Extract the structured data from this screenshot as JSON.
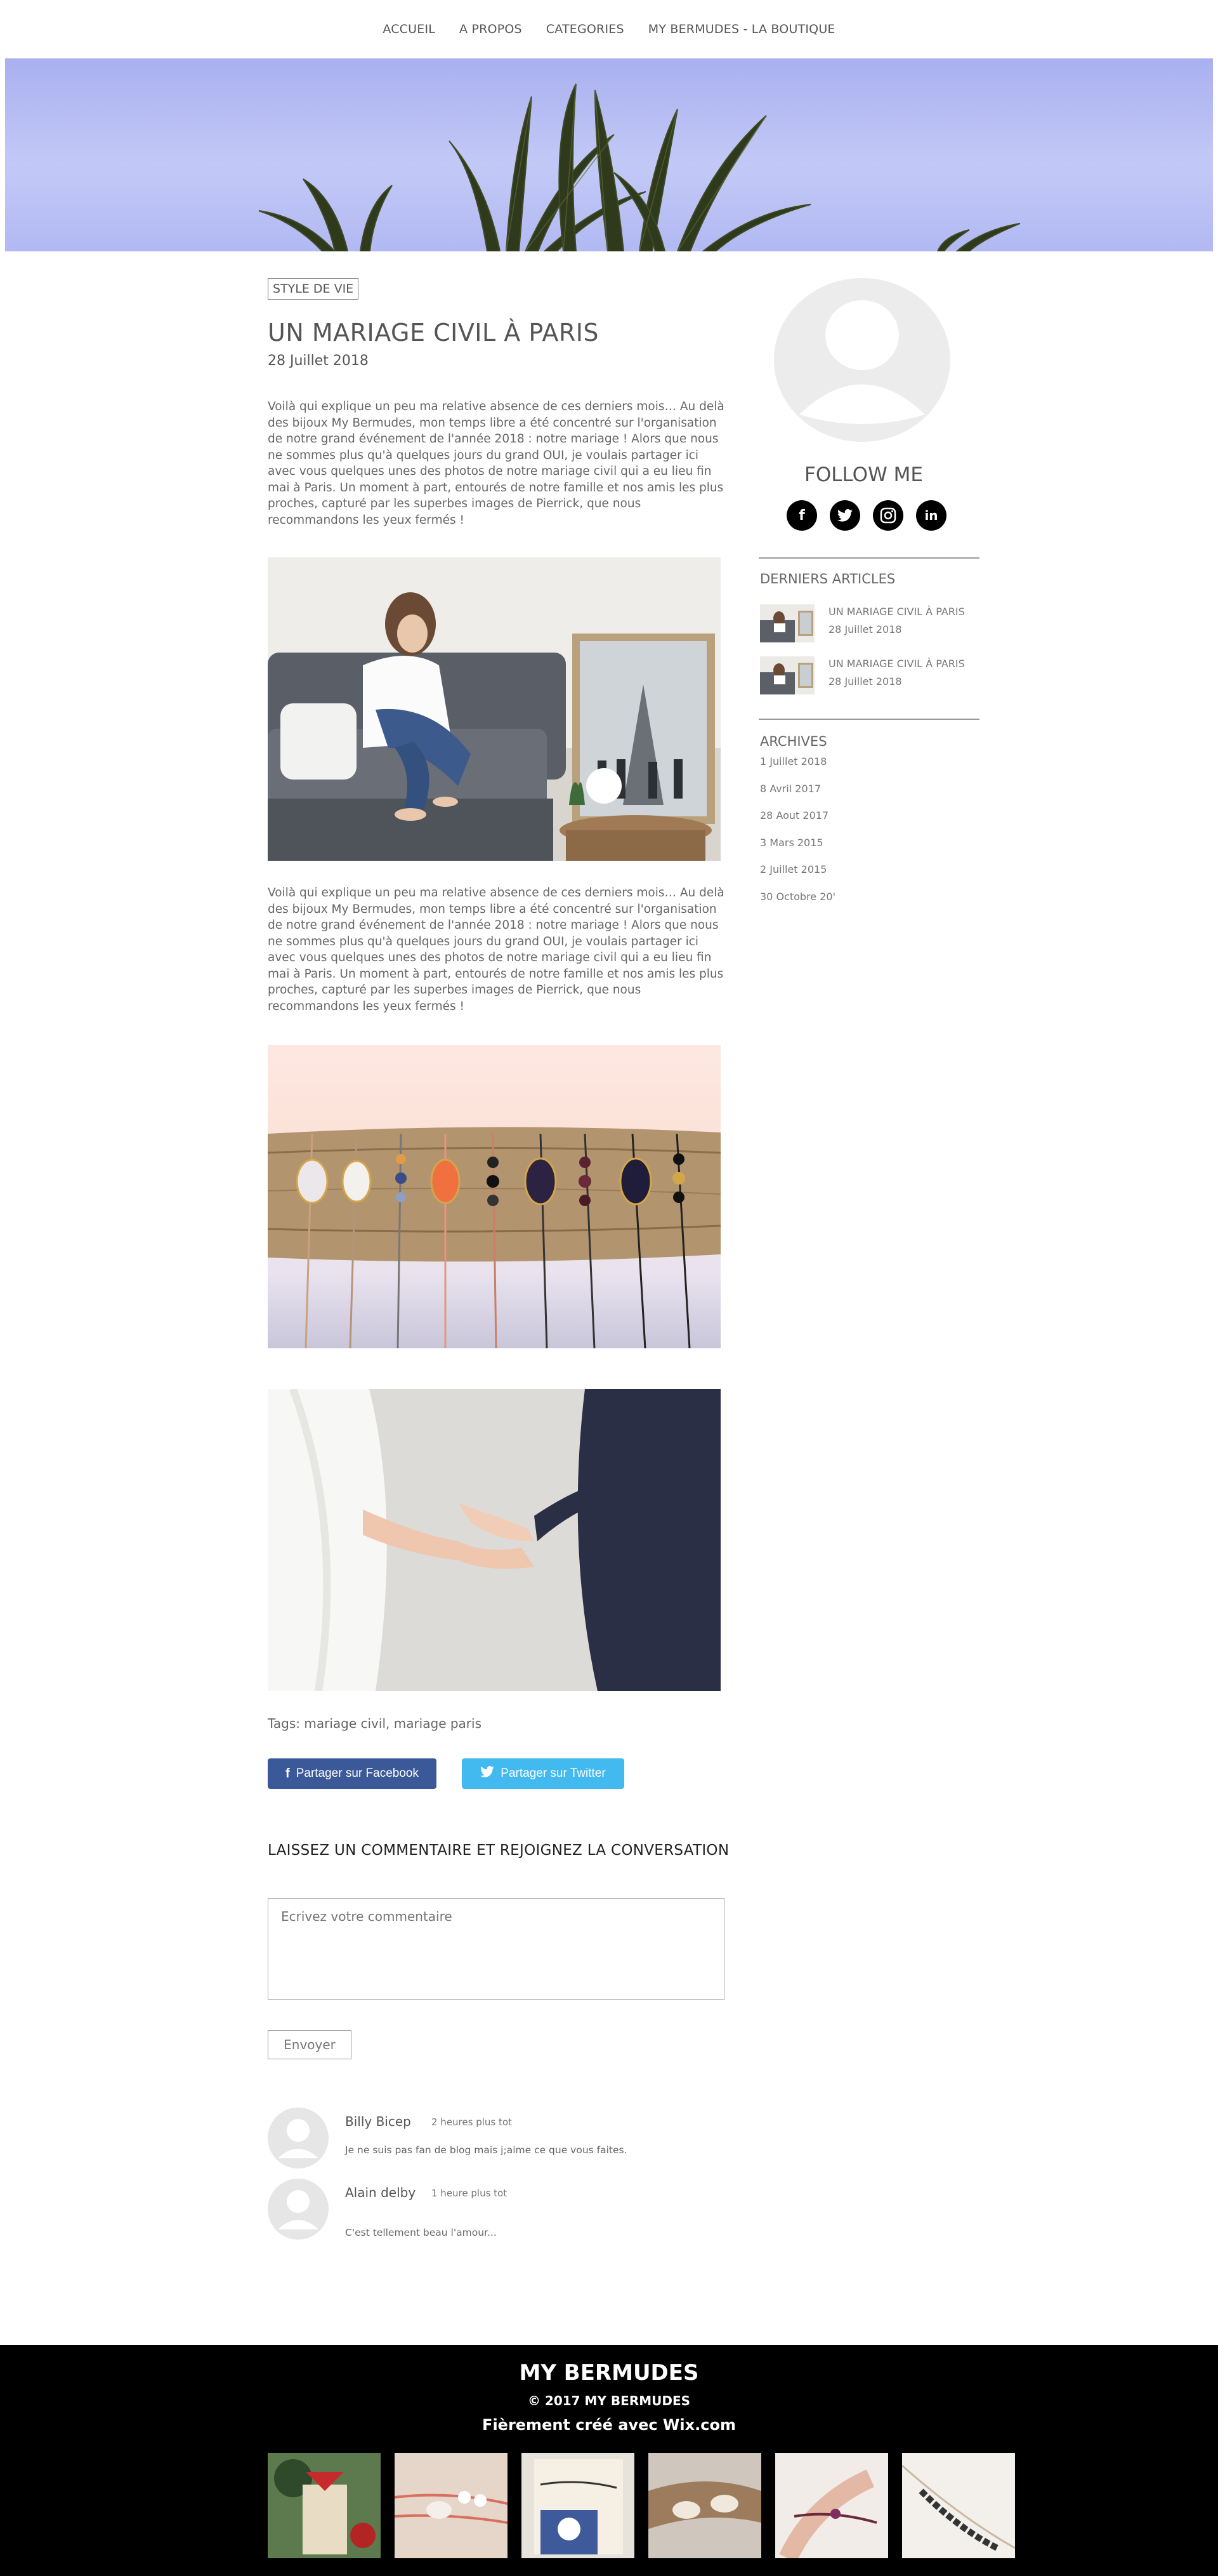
{
  "nav": {
    "items": [
      "ACCUEIL",
      "A PROPOS",
      "CATEGORIES",
      "MY BERMUDES - LA BOUTIQUE"
    ]
  },
  "post": {
    "category": "STYLE DE VIE",
    "title": "UN MARIAGE CIVIL À PARIS",
    "date": "28 Juillet  2018",
    "paragraph1": "Voilà qui explique un peu ma relative absence de ces derniers mois… Au delà des bijoux My Bermudes, mon temps libre a été concentré sur l'organisation de notre grand événement de l'année 2018 : notre mariage ! Alors que nous ne sommes plus qu'à quelques jours du grand OUI, je voulais partager ici avec vous quelques unes des photos de notre mariage civil qui a eu lieu fin mai à Paris. Un moment à part, entourés de notre famille et nos amis les plus proches, capturé par les superbes images de Pierrick, que nous recommandons les yeux fermés !",
    "paragraph2": "Voilà qui explique un peu ma relative absence de ces derniers mois… Au delà des bijoux My Bermudes, mon temps libre a été concentré sur l'organisation de notre grand événement de l'année 2018 : notre mariage ! Alors que nous ne sommes plus qu'à quelques jours du grand OUI, je voulais partager ici avec vous quelques unes des photos de notre mariage civil qui a eu lieu fin mai à Paris. Un moment à part, entourés de notre famille et nos amis les plus proches, capturé par les superbes images de Pierrick, que nous recommandons les yeux fermés !",
    "tags": "Tags: mariage civil, mariage paris"
  },
  "share": {
    "facebook": "Partager sur Facebook",
    "twitter": "Partager sur Twitter"
  },
  "comments": {
    "heading": "LAISSEZ UN COMMENTAIRE ET REJOIGNEZ LA CONVERSATION",
    "placeholder": "Ecrivez votre commentaire",
    "send_label": "Envoyer",
    "items": [
      {
        "name": "Billy Bicep",
        "time": "2 heures plus tot",
        "text": "Je ne suis pas fan de blog mais j;aime ce que vous faites."
      },
      {
        "name": "Alain delby",
        "time": "1 heure plus tot",
        "text": "C'est tellement beau l'amour..."
      }
    ]
  },
  "sidebar": {
    "follow": "FOLLOW ME",
    "socials": [
      "facebook-icon",
      "twitter-icon",
      "instagram-icon",
      "linkedin-icon"
    ],
    "recent_heading": "DERNIERS ARTICLES",
    "recent": [
      {
        "title": "UN MARIAGE CIVIL À PARIS",
        "date": "28 Juillet  2018"
      },
      {
        "title": "UN MARIAGE CIVIL À PARIS",
        "date": "28 Juillet  2018"
      }
    ],
    "archives_heading": "ARCHIVES",
    "archives": [
      "1 Juillet  2018",
      "8 Avril  2017",
      "28 Aout  2017",
      "3 Mars  2015",
      "2 Juillet  2015",
      "30 Octobre  20'"
    ]
  },
  "footer": {
    "brand": "MY BERMUDES",
    "copyright": "© 2017 MY BERMUDES",
    "wix": "Fièrement créé avec Wix.com"
  },
  "colors": {
    "facebook": "#3b5998",
    "twitter": "#42b9ef",
    "footer_bg": "#000000",
    "hero_sky": "#b7bdf4"
  }
}
